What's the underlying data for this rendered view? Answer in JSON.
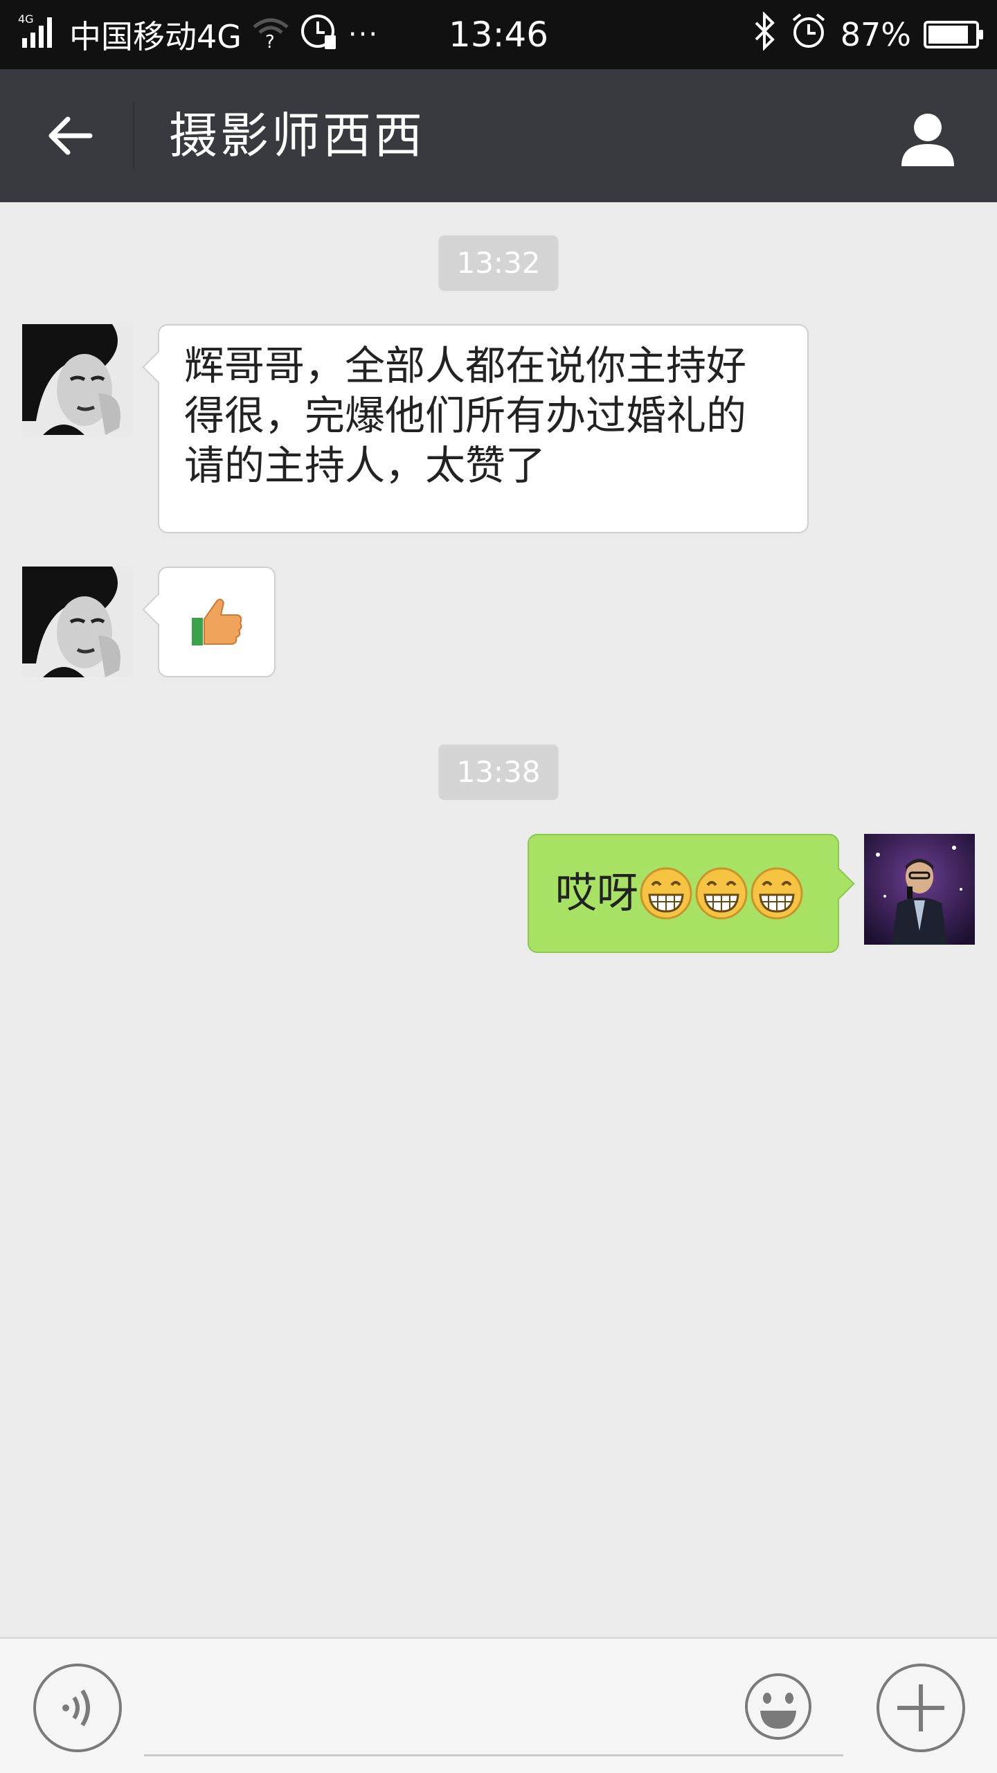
{
  "status_bar": {
    "network_type": "4G",
    "carrier": "中国移动4G",
    "time": "13:46",
    "battery": "87%",
    "battery_level": 0.87,
    "icons": [
      "signal-icon",
      "wifi-icon",
      "sim-icon",
      "more-icon",
      "bluetooth-icon",
      "alarm-icon",
      "battery-icon"
    ]
  },
  "header": {
    "title": "摄影师西西",
    "back_icon": "arrow-left-icon",
    "profile_icon": "person-icon"
  },
  "messages": [
    {
      "type": "timestamp",
      "text": "13:32"
    },
    {
      "type": "text",
      "direction": "incoming",
      "text": "辉哥哥，全部人都在说你主持好得很，完爆他们所有办过婚礼的请的主持人，太赞了"
    },
    {
      "type": "emoji",
      "direction": "incoming",
      "emoji": "thumbs-up-icon"
    },
    {
      "type": "timestamp",
      "text": "13:38"
    },
    {
      "type": "text",
      "direction": "outgoing",
      "text": "哎呀",
      "emojis": [
        "grin-icon",
        "grin-icon",
        "grin-icon"
      ]
    }
  ],
  "input_bar": {
    "voice_icon": "voice-icon",
    "text_value": "",
    "emoji_icon": "smiley-icon",
    "plus_icon": "plus-icon"
  },
  "colors": {
    "status_bar_bg": "#111111",
    "title_bar_bg": "#393a3f",
    "chat_bg": "#ebebeb",
    "incoming_bubble": "#ffffff",
    "outgoing_bubble": "#a8e264",
    "timestamp_chip": "#d4d4d4"
  }
}
